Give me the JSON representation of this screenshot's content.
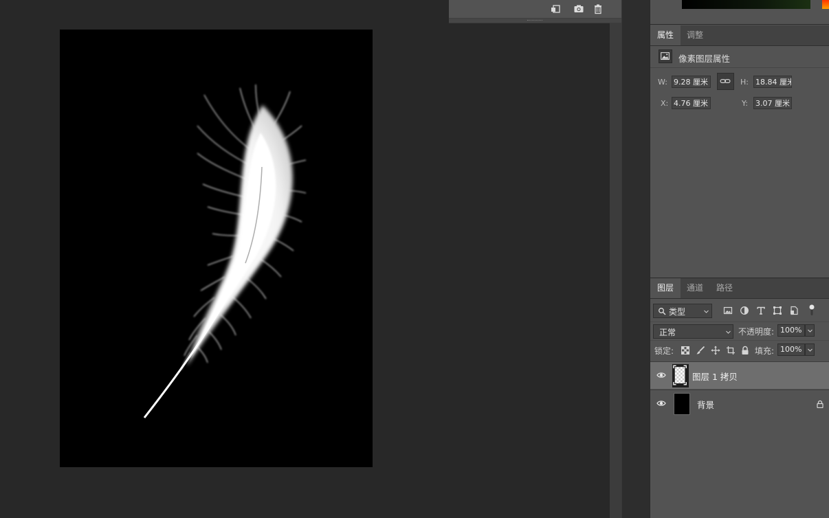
{
  "float_panel": {
    "icons": [
      "new-document-from-state-icon",
      "camera-snapshot-icon",
      "trash-icon"
    ]
  },
  "properties": {
    "tabs": [
      {
        "label": "属性",
        "active": true
      },
      {
        "label": "调整",
        "active": false
      }
    ],
    "header": "像素图层属性",
    "w_label": "W:",
    "w_value": "9.28 厘米",
    "h_label": "H:",
    "h_value": "18.84 厘米",
    "x_label": "X:",
    "x_value": "4.76 厘米",
    "y_label": "Y:",
    "y_value": "3.07 厘米"
  },
  "layers_panel": {
    "tabs": [
      {
        "label": "图层",
        "active": true
      },
      {
        "label": "通道",
        "active": false
      },
      {
        "label": "路径",
        "active": false
      }
    ],
    "filter_label": "类型",
    "filter_icons": [
      "image-filter-icon",
      "adjustment-filter-icon",
      "type-filter-icon",
      "shape-filter-icon",
      "smart-object-filter-icon"
    ],
    "blend_mode": "正常",
    "opacity_label": "不透明度:",
    "opacity_value": "100%",
    "lock_label": "锁定:",
    "lock_icons": [
      "lock-transparent-pixels-icon",
      "lock-image-pixels-icon",
      "lock-position-icon",
      "lock-artboard-icon",
      "lock-all-icon"
    ],
    "fill_label": "填充:",
    "fill_value": "100%",
    "layers": [
      {
        "name": "图层 1 拷贝",
        "selected": true,
        "visible": true,
        "locked": false
      },
      {
        "name": "背景",
        "selected": false,
        "visible": true,
        "locked": true
      }
    ]
  },
  "colors": {
    "workspace_bg": "#282828",
    "panel_bg": "#535353",
    "selected_layer_bg": "#6e6e6e",
    "canvas_bg": "#000000"
  }
}
